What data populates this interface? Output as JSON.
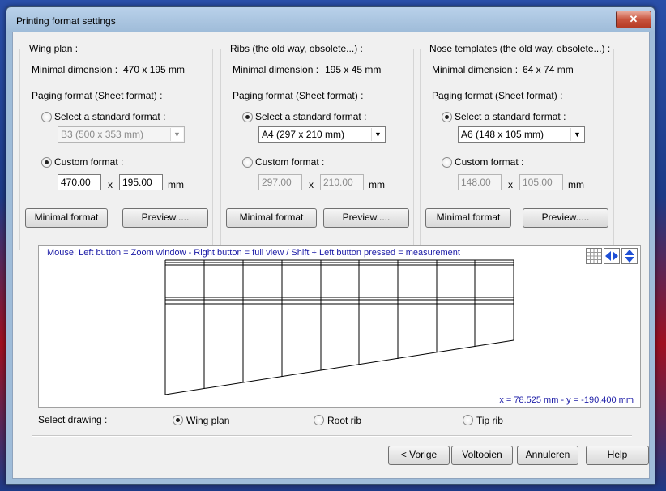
{
  "window": {
    "title": "Printing format settings",
    "close_glyph": "✕"
  },
  "groups": [
    {
      "title": "Wing plan :",
      "min_dim_label": "Minimal dimension :",
      "min_dim_value": "470 x 195 mm",
      "paging_label": "Paging format (Sheet format) :",
      "standard_label": "Select a standard format :",
      "standard_selected": false,
      "standard_value": "B3 (500 x 353 mm)",
      "standard_enabled": false,
      "custom_label": "Custom format :",
      "custom_selected": true,
      "width": "470.00",
      "height": "195.00",
      "custom_enabled": true,
      "x_label": "x",
      "unit": "mm",
      "minimal_button": "Minimal format",
      "preview_button": "Preview....."
    },
    {
      "title": "Ribs (the old way, obsolete...) :",
      "min_dim_label": "Minimal dimension :",
      "min_dim_value": "195 x 45 mm",
      "paging_label": "Paging format (Sheet format) :",
      "standard_label": "Select a standard format :",
      "standard_selected": true,
      "standard_value": "A4 (297 x 210 mm)",
      "standard_enabled": true,
      "custom_label": "Custom format :",
      "custom_selected": false,
      "width": "297.00",
      "height": "210.00",
      "custom_enabled": false,
      "x_label": "x",
      "unit": "mm",
      "minimal_button": "Minimal format",
      "preview_button": "Preview....."
    },
    {
      "title": "Nose templates (the old way, obsolete...) :",
      "min_dim_label": "Minimal dimension :",
      "min_dim_value": "64 x 74 mm",
      "paging_label": "Paging format (Sheet format) :",
      "standard_label": "Select a standard format :",
      "standard_selected": true,
      "standard_value": "A6 (148 x 105 mm)",
      "standard_enabled": true,
      "custom_label": "Custom format :",
      "custom_selected": false,
      "width": "148.00",
      "height": "105.00",
      "custom_enabled": false,
      "x_label": "x",
      "unit": "mm",
      "minimal_button": "Minimal format",
      "preview_button": "Preview....."
    }
  ],
  "preview": {
    "mouse_help": "Mouse: Left button = Zoom window - Right button = full view / Shift + Left button pressed = measurement",
    "coords": "x = 78.525 mm - y = -190.400 mm",
    "tools": [
      "grid-icon",
      "horizontal-arrows-icon",
      "vertical-arrows-icon"
    ]
  },
  "select_drawing": {
    "label": "Select drawing :",
    "options": [
      {
        "label": "Wing plan",
        "selected": true
      },
      {
        "label": "Root rib",
        "selected": false
      },
      {
        "label": "Tip rib",
        "selected": false
      }
    ]
  },
  "buttons": {
    "back": "< Vorige",
    "finish": "Voltooien",
    "cancel": "Annuleren",
    "help": "Help"
  },
  "colors": {
    "info_text": "#1a1aa6",
    "accent_blue": "#1e4fd6"
  }
}
